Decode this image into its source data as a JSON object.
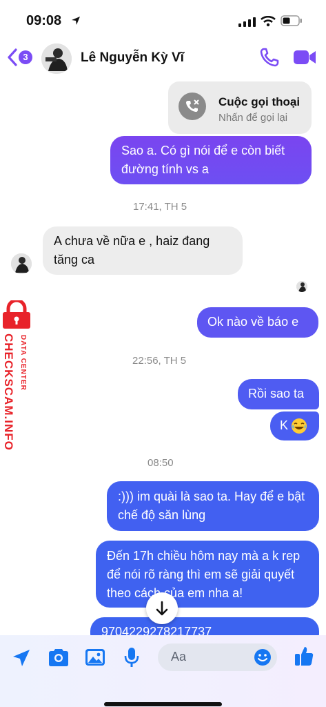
{
  "status": {
    "time": "09:08"
  },
  "header": {
    "badge": "3",
    "name": "Lê Nguyễn Kỳ Vĩ"
  },
  "call": {
    "title": "Cuộc gọi thoại",
    "subtitle": "Nhấn để gọi lại"
  },
  "messages": {
    "m1": "Sao a. Có gì nói để e còn biết đường tính vs a",
    "ts1": "17:41, TH 5",
    "m2": "A chưa về nữa e , haiz đang tăng ca",
    "m3": "Ok nào về báo e",
    "ts2": "22:56, TH 5",
    "m4": "Rồi sao ta",
    "m5": "K",
    "ts3": "08:50",
    "m6": ":))) im quài là sao ta. Hay để e bật chế độ săn lùng",
    "m7": "Đến 17h chiều hôm nay mà a k rep để nói rõ ràng thì em sẽ giải quyết theo cách của em nha a!",
    "m8": "9704229278217737"
  },
  "watermark": {
    "brand": "CHECKSCAM.INFO",
    "sub": "DATA CENTER"
  },
  "composer": {
    "placeholder": "Aa"
  },
  "colors": {
    "accent": "#7b4cf5",
    "bubble_top": "#7a45f0",
    "bubble_bottom": "#3b5ef0",
    "watermark": "#e8232a"
  }
}
